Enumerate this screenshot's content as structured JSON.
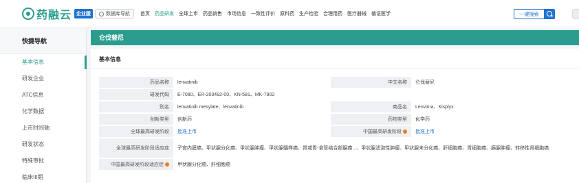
{
  "brand": {
    "name": "药融云",
    "badge": "企业版"
  },
  "db_nav": {
    "label": "数据库导航"
  },
  "menu": [
    {
      "label": "首页",
      "active": false
    },
    {
      "label": "药品研发",
      "active": true
    },
    {
      "label": "全球上市",
      "active": false
    },
    {
      "label": "药品销售",
      "active": false
    },
    {
      "label": "市场信息",
      "active": false
    },
    {
      "label": "一致性评价",
      "active": false
    },
    {
      "label": "原料药",
      "active": false
    },
    {
      "label": "生产检验",
      "active": false
    },
    {
      "label": "合理用药",
      "active": false
    },
    {
      "label": "医疗器械",
      "active": false
    },
    {
      "label": "循证医学",
      "active": false
    }
  ],
  "search": {
    "placeholder": "一键搜索"
  },
  "sidebar": {
    "title": "快捷导航",
    "items": [
      {
        "label": "基本信息",
        "active": true
      },
      {
        "label": "研发企业",
        "active": false
      },
      {
        "label": "ATC信息",
        "active": false
      },
      {
        "label": "化学数据",
        "active": false
      },
      {
        "label": "上市时间轴",
        "active": false
      },
      {
        "label": "研发状态",
        "active": false
      },
      {
        "label": "特殊审批",
        "active": false
      },
      {
        "label": "临床III期",
        "active": false
      }
    ]
  },
  "page": {
    "title": "仑伐替尼",
    "section": "基本信息"
  },
  "fields": {
    "drug_name_label": "药品名称",
    "drug_name": "lenvatinib",
    "cn_name_label": "中文名称",
    "cn_name": "仑伐替尼",
    "dev_code_label": "研发代码",
    "dev_code": "E-7080、ER-203492-00、KN-581、MK-7902",
    "alias_label": "别名",
    "alias": "lenvatinib mesylate、lenvatinib",
    "trade_name_label": "商品名",
    "trade_name": "Lenvima、Kisplyx",
    "innovation_label": "创新类型",
    "innovation": "创新药",
    "drug_type_label": "药物类型",
    "drug_type": "化学药",
    "global_stage_label": "全球最高研发阶段",
    "global_stage": "批准上市",
    "china_stage_label": "中国最高研发阶段",
    "china_stage": "批准上市",
    "global_indication_label": "全球最高研发阶段适应症",
    "global_indication": "子宫内膜癌、甲状腺分化癌、甲状腺肿瘤、甲状腺髓样癌、胃或胃-食管结合部腺癌...、甲状腺滤泡性肿瘤、甲状腺未分化癌、肝细胞癌、胃细胞癌、胰腺肿瘤、转移性肾细胞癌",
    "china_indication_label": "中国最高研发阶段适应症",
    "china_indication": "甲状腺分化癌、肝细胞癌"
  },
  "colors": {
    "accent": "#2a9d8f",
    "link": "#1f73d2",
    "label_bg": "#eef0f3",
    "info": "#e67e22"
  }
}
